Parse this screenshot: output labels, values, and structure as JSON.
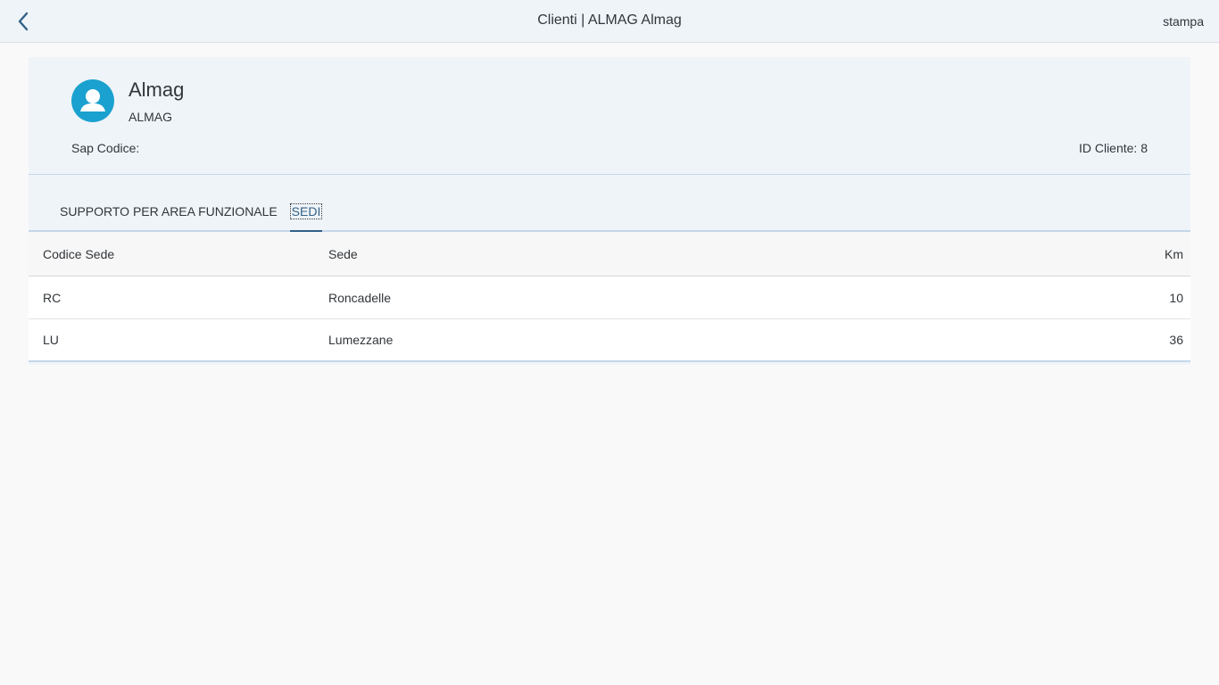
{
  "shell": {
    "title": "Clienti | ALMAG Almag",
    "print_label": "stampa"
  },
  "object": {
    "title": "Almag",
    "subtitle": "ALMAG",
    "sap_label": "Sap Codice:",
    "id_label": "ID Cliente: 8"
  },
  "tabs": [
    {
      "label": "SUPPORTO PER AREA FUNZIONALE",
      "selected": false
    },
    {
      "label": "SEDI",
      "selected": true
    }
  ],
  "table": {
    "headers": [
      "Codice Sede",
      "Sede",
      "Km"
    ],
    "rows": [
      [
        "RC",
        "Roncadelle",
        "10"
      ],
      [
        "LU",
        "Lumezzane",
        "36"
      ]
    ]
  },
  "colors": {
    "accent": "#346187",
    "avatar": "#1ba1cf",
    "header_bg": "#eff4f9"
  },
  "icons": {
    "back": "nav-back-icon",
    "avatar": "person-placeholder-icon"
  }
}
